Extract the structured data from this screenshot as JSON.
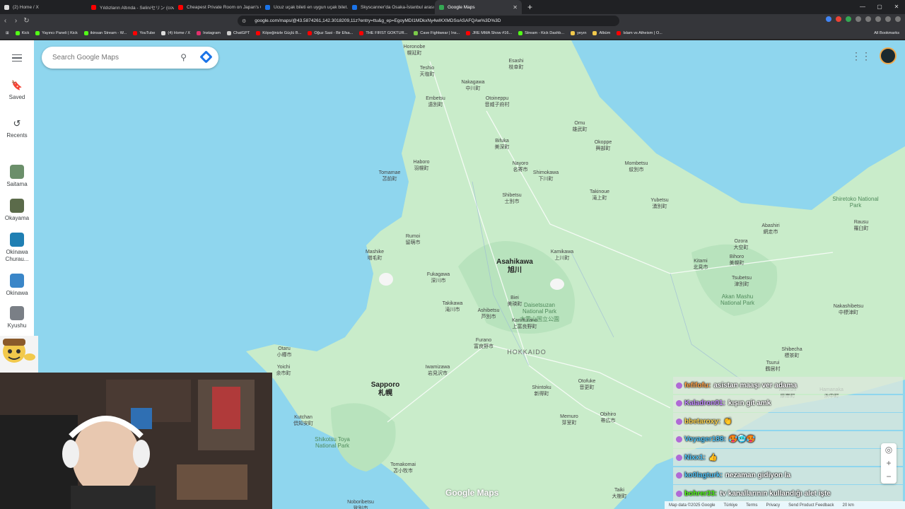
{
  "browser": {
    "tabs": [
      {
        "title": "(2) Home / X",
        "color": "#ddd"
      },
      {
        "title": "Yıldızların Altında - Selin/セリン (cover)",
        "color": "#ff0000"
      },
      {
        "title": "Cheapest Private Room on Japan's C...",
        "color": "#ff0000"
      },
      {
        "title": "Ucuz uçak bileti en uygun uçak bilet...",
        "color": "#1a73e8"
      },
      {
        "title": "Skyscanner'da Osaka-İstanbul arası u...",
        "color": "#1a73e8"
      },
      {
        "title": "Google Maps",
        "color": "#34a853"
      }
    ],
    "url": "google.com/maps/@43.5874261,142.3018209,11z?entry=ttu&g_ep=EgoyMDI1MDkxNy4wIKXMDSoASAFQAw%3D%3D",
    "bookmarks": [
      {
        "label": "Kick",
        "color": "#53fc18"
      },
      {
        "label": "Yayıncı Paneli | Kick",
        "color": "#53fc18"
      },
      {
        "label": "ikinsan Stream - W...",
        "color": "#53fc18"
      },
      {
        "label": "YouTube",
        "color": "#ff0000"
      },
      {
        "label": "(4) Home / X",
        "color": "#ddd"
      },
      {
        "label": "Instagram",
        "color": "#e1306c"
      },
      {
        "label": "ChatGPT",
        "color": "#ccc"
      },
      {
        "label": "Köpeğinizle Güçlü B...",
        "color": "#ff0000"
      },
      {
        "label": "Oğuz Sasi - Bir Efsa...",
        "color": "#ff0000"
      },
      {
        "label": "THE FIRST GOKTUR...",
        "color": "#ff0000"
      },
      {
        "label": "Cave Fightwear | Ins...",
        "color": "#7ccb4a"
      },
      {
        "label": "JRE MMA Show #16...",
        "color": "#ff0000"
      },
      {
        "label": "Stream - Kick Dashb...",
        "color": "#53fc18"
      },
      {
        "label": "yeyın",
        "color": "#f2c94c"
      },
      {
        "label": "Albüm",
        "color": "#f2c94c"
      },
      {
        "label": "Islam vs Atheism | O...",
        "color": "#ff0000"
      }
    ],
    "all_bookmarks": "All Bookmarks"
  },
  "maps": {
    "search_placeholder": "Search Google Maps",
    "sidebar": [
      {
        "label": "Saved",
        "icon": "bookmark-icon"
      },
      {
        "label": "Recents",
        "icon": "history-icon"
      },
      {
        "label": "Saitama",
        "thumb": "#6b8f6a"
      },
      {
        "label": "Okayama",
        "thumb": "#5b6b4a"
      },
      {
        "label": "Okinawa Churau...",
        "thumb": "#1f7fb3"
      },
      {
        "label": "Okinawa",
        "thumb": "#3a86c8"
      },
      {
        "label": "Kyushu",
        "thumb": "#7a7f86"
      }
    ],
    "places": [
      {
        "name": "Horonobe",
        "jp": "幌延町"
      },
      {
        "name": "Esashi",
        "jp": "枝幸町"
      },
      {
        "name": "Teshio",
        "jp": "天塩町"
      },
      {
        "name": "Nakagawa",
        "jp": "中川町"
      },
      {
        "name": "Embetsu",
        "jp": "遠別町"
      },
      {
        "name": "Otoineppu",
        "jp": "音威子府村"
      },
      {
        "name": "Omu",
        "jp": "雄武町"
      },
      {
        "name": "Bifuka",
        "jp": "美深町"
      },
      {
        "name": "Okoppe",
        "jp": "興部町"
      },
      {
        "name": "Haboro",
        "jp": "羽幌町"
      },
      {
        "name": "Nayoro",
        "jp": "名寄市"
      },
      {
        "name": "Shimokawa",
        "jp": "下川町"
      },
      {
        "name": "Mombetsu",
        "jp": "紋別市"
      },
      {
        "name": "Tomamae",
        "jp": "苫前町"
      },
      {
        "name": "Shibetsu",
        "jp": "士別市"
      },
      {
        "name": "Takinoue",
        "jp": "滝上町"
      },
      {
        "name": "Yubetsu",
        "jp": "湧別町"
      },
      {
        "name": "Rumoi",
        "jp": "留萌市"
      },
      {
        "name": "Abashiri",
        "jp": "網走市"
      },
      {
        "name": "Mashike",
        "jp": "増毛町"
      },
      {
        "name": "Kamikawa",
        "jp": "上川町"
      },
      {
        "name": "Ozora",
        "jp": "大空町"
      },
      {
        "name": "Kitami",
        "jp": "北見市"
      },
      {
        "name": "Bihoro",
        "jp": "美幌町"
      },
      {
        "name": "Fukagawa",
        "jp": "深川市"
      },
      {
        "name": "Tsubetsu",
        "jp": "津別町"
      },
      {
        "name": "Biei",
        "jp": "美瑛町"
      },
      {
        "name": "Takikawa",
        "jp": "滝川市"
      },
      {
        "name": "Ashibetsu",
        "jp": "芦別市"
      },
      {
        "name": "Kamifurano",
        "jp": "上富良野町"
      },
      {
        "name": "Furano",
        "jp": "富良野市"
      },
      {
        "name": "Otaru",
        "jp": "小樽市"
      },
      {
        "name": "Yoichi",
        "jp": "余市町"
      },
      {
        "name": "Iwamizawa",
        "jp": "岩見沢市"
      },
      {
        "name": "Shintoku",
        "jp": "新得町"
      },
      {
        "name": "Otofuke",
        "jp": "音更町"
      },
      {
        "name": "Shibecha",
        "jp": "標茶町"
      },
      {
        "name": "Tsurui",
        "jp": "鶴居村"
      },
      {
        "name": "Kutchan",
        "jp": "倶知安町"
      },
      {
        "name": "Memuro",
        "jp": "芽室町"
      },
      {
        "name": "Obihiro",
        "jp": "帯広市"
      },
      {
        "name": "Tomakomai",
        "jp": "苫小牧市"
      },
      {
        "name": "Taiki",
        "jp": "大樹町"
      },
      {
        "name": "Noboribetsu",
        "jp": "登別市"
      },
      {
        "name": "Akkeshi",
        "jp": "厚岸町"
      },
      {
        "name": "Hamanaka",
        "jp": "浜中町"
      },
      {
        "name": "Rausu",
        "jp": "羅臼町"
      },
      {
        "name": "Nakashibetsu",
        "jp": "中標津町"
      }
    ],
    "cities": [
      {
        "name": "Asahikawa",
        "jp": "旭川"
      },
      {
        "name": "Sapporo",
        "jp": "札幌"
      }
    ],
    "region": "HOKKAIDO",
    "parks": [
      "Daisetsuzan National Park",
      "Akan Mashu National Park",
      "Shikotsu Toya National Park",
      "Shiretoko National Park"
    ],
    "park_jp": "大雪山国立公園",
    "attribution": [
      "Map data ©2025 Google",
      "Türkiye",
      "Terms",
      "Privacy",
      "Send Product Feedback",
      "20 km"
    ],
    "logo": "Google Maps"
  },
  "chat": [
    {
      "user": "fefifofu:",
      "msg": "asistan maaşı ver adama",
      "color": "#ff9f43"
    },
    {
      "user": "Kaladron01:",
      "msg": "kışın git amk",
      "color": "#c38cff"
    },
    {
      "user": "bbetaroxy:",
      "msg": "👏",
      "color": "#ffd54f"
    },
    {
      "user": "Voyager188:",
      "msg": "🥵🥶🥵",
      "color": "#4fc3f7"
    },
    {
      "user": "Nixx1:",
      "msg": "👍",
      "color": "#4fc3f7"
    },
    {
      "user": "ko0lagturk:",
      "msg": "nezaman gidiyon la",
      "color": "#4fc3f7"
    },
    {
      "user": "bohrer33:",
      "msg": "tv kanallarının kullandığı alet işte",
      "color": "#53fc18"
    }
  ]
}
